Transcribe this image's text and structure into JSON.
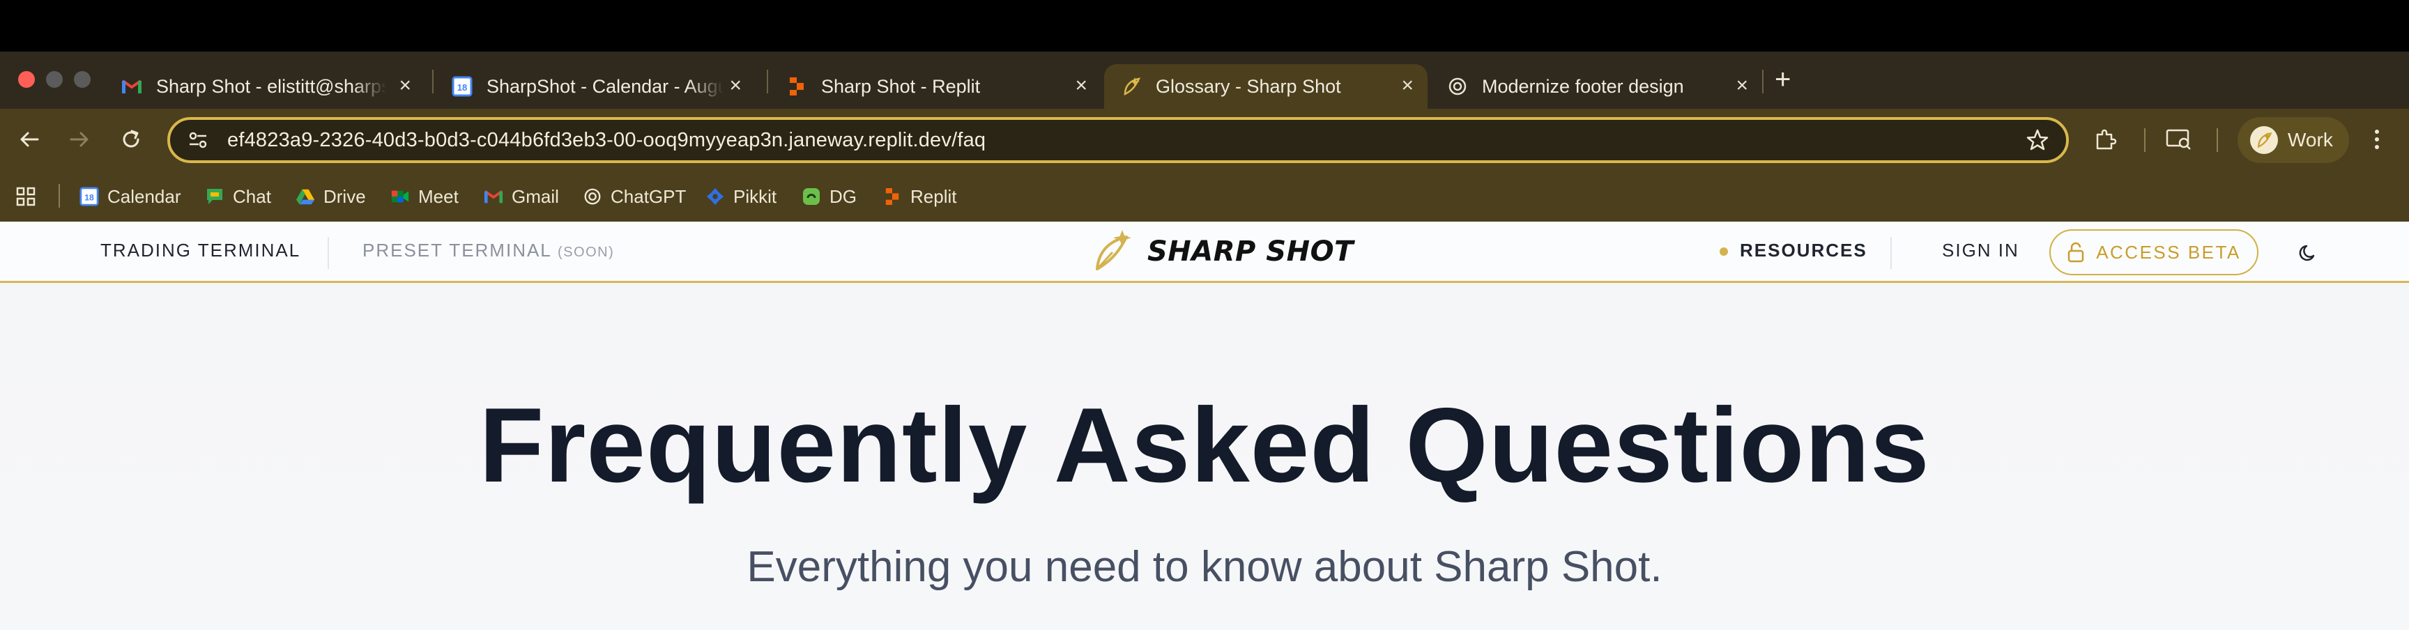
{
  "browser": {
    "tabs": [
      {
        "title": "Sharp Shot - elistitt@sharpshot",
        "favicon": "gmail-icon"
      },
      {
        "title": "SharpShot - Calendar - August",
        "favicon": "calendar-icon"
      },
      {
        "title": "Sharp Shot - Replit",
        "favicon": "replit-icon"
      },
      {
        "title": "Glossary - Sharp Shot",
        "favicon": "sharpshot-icon",
        "active": true
      },
      {
        "title": "Modernize footer design",
        "favicon": "chatgpt-icon"
      }
    ],
    "address": "ef4823a9-2326-40d3-b0d3-c044b6fd3eb3-00-ooq9myyeap3n.janeway.replit.dev/faq",
    "profile_label": "Work",
    "bookmarks": [
      {
        "label": "Calendar",
        "icon": "calendar-icon"
      },
      {
        "label": "Chat",
        "icon": "chat-icon"
      },
      {
        "label": "Drive",
        "icon": "drive-icon"
      },
      {
        "label": "Meet",
        "icon": "meet-icon"
      },
      {
        "label": "Gmail",
        "icon": "gmail-icon"
      },
      {
        "label": "ChatGPT",
        "icon": "chatgpt-icon"
      },
      {
        "label": "Pikkit",
        "icon": "pikkit-icon"
      },
      {
        "label": "DG",
        "icon": "dg-icon"
      },
      {
        "label": "Replit",
        "icon": "replit-icon"
      }
    ]
  },
  "site": {
    "nav": {
      "trading_terminal": "TRADING TERMINAL",
      "preset_terminal": "PRESET TERMINAL",
      "soon": "(SOON)",
      "brand": "SHARP SHOT",
      "resources": "RESOURCES",
      "sign_in": "SIGN IN",
      "access_beta": "ACCESS BETA"
    },
    "hero": {
      "title": "Frequently Asked Questions",
      "subtitle": "Everything you need to know about Sharp Shot."
    }
  },
  "colors": {
    "accent_gold": "#d4b24f",
    "chrome_dark": "#4b3f1d",
    "heading": "#141b2a"
  }
}
